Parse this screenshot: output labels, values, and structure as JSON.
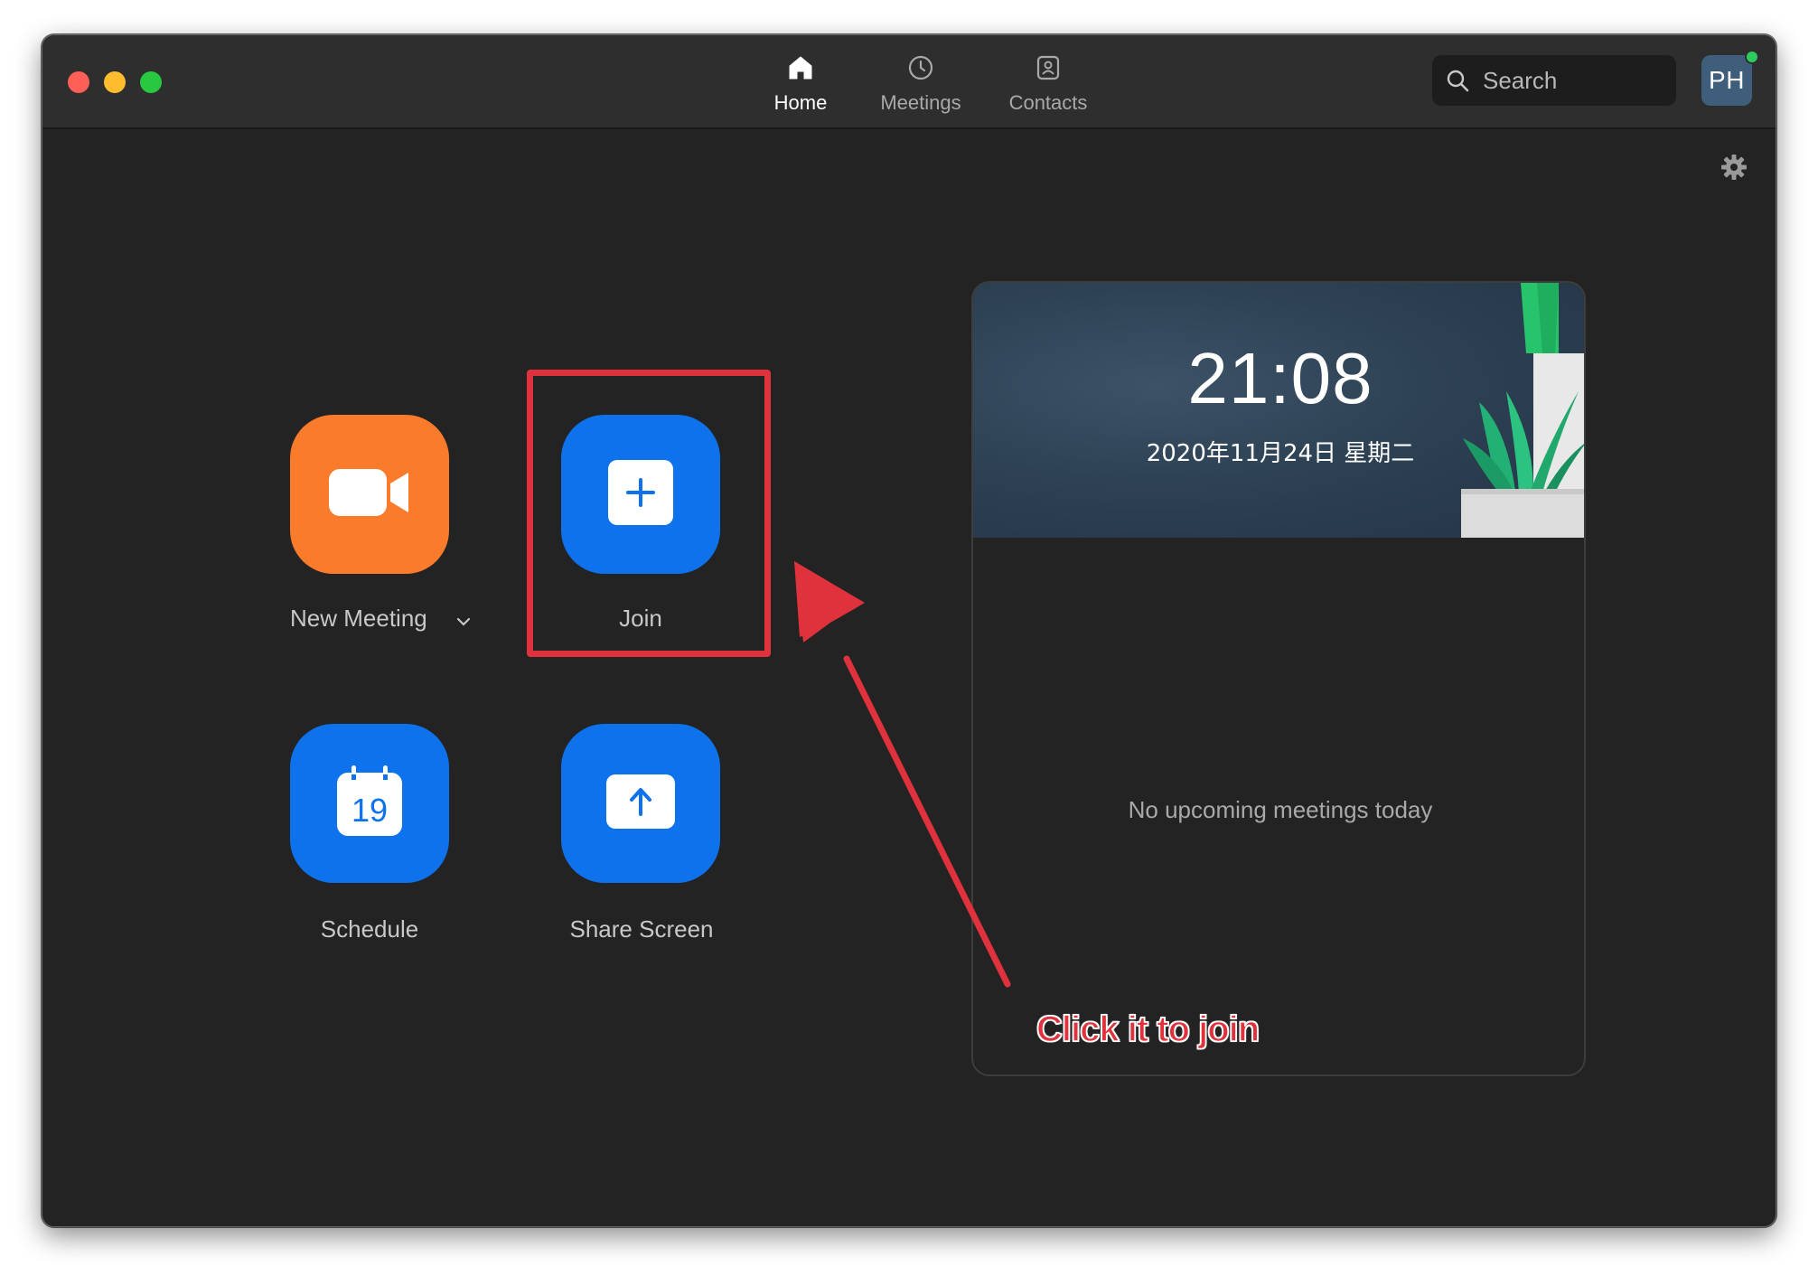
{
  "window": {
    "nav": [
      {
        "label": "Home",
        "icon": "home-icon",
        "active": true
      },
      {
        "label": "Meetings",
        "icon": "clock-icon",
        "active": false
      },
      {
        "label": "Contacts",
        "icon": "contacts-icon",
        "active": false
      }
    ],
    "search": {
      "placeholder": "Search",
      "icon": "search-icon"
    },
    "avatar": {
      "initials": "PH",
      "status_color": "#2ecc5e"
    }
  },
  "actions": {
    "new_meeting": {
      "label": "New Meeting",
      "icon": "video-camera-icon",
      "color": "#f97b2b"
    },
    "join": {
      "label": "Join",
      "icon": "plus-icon",
      "color": "#0e72ed"
    },
    "schedule": {
      "label": "Schedule",
      "icon": "calendar-icon",
      "calendar_day": "19",
      "color": "#0e72ed"
    },
    "share_screen": {
      "label": "Share Screen",
      "icon": "upload-arrow-icon",
      "color": "#0e72ed"
    }
  },
  "card": {
    "time": "21:08",
    "date": "2020年11月24日 星期二",
    "empty_message": "No upcoming meetings today"
  },
  "annotation": {
    "text": "Click it to join",
    "color": "#e0323c"
  },
  "colors": {
    "background": "#232323",
    "titlebar": "#2e2e2e",
    "accent_blue": "#0e72ed",
    "accent_orange": "#f97b2b"
  }
}
